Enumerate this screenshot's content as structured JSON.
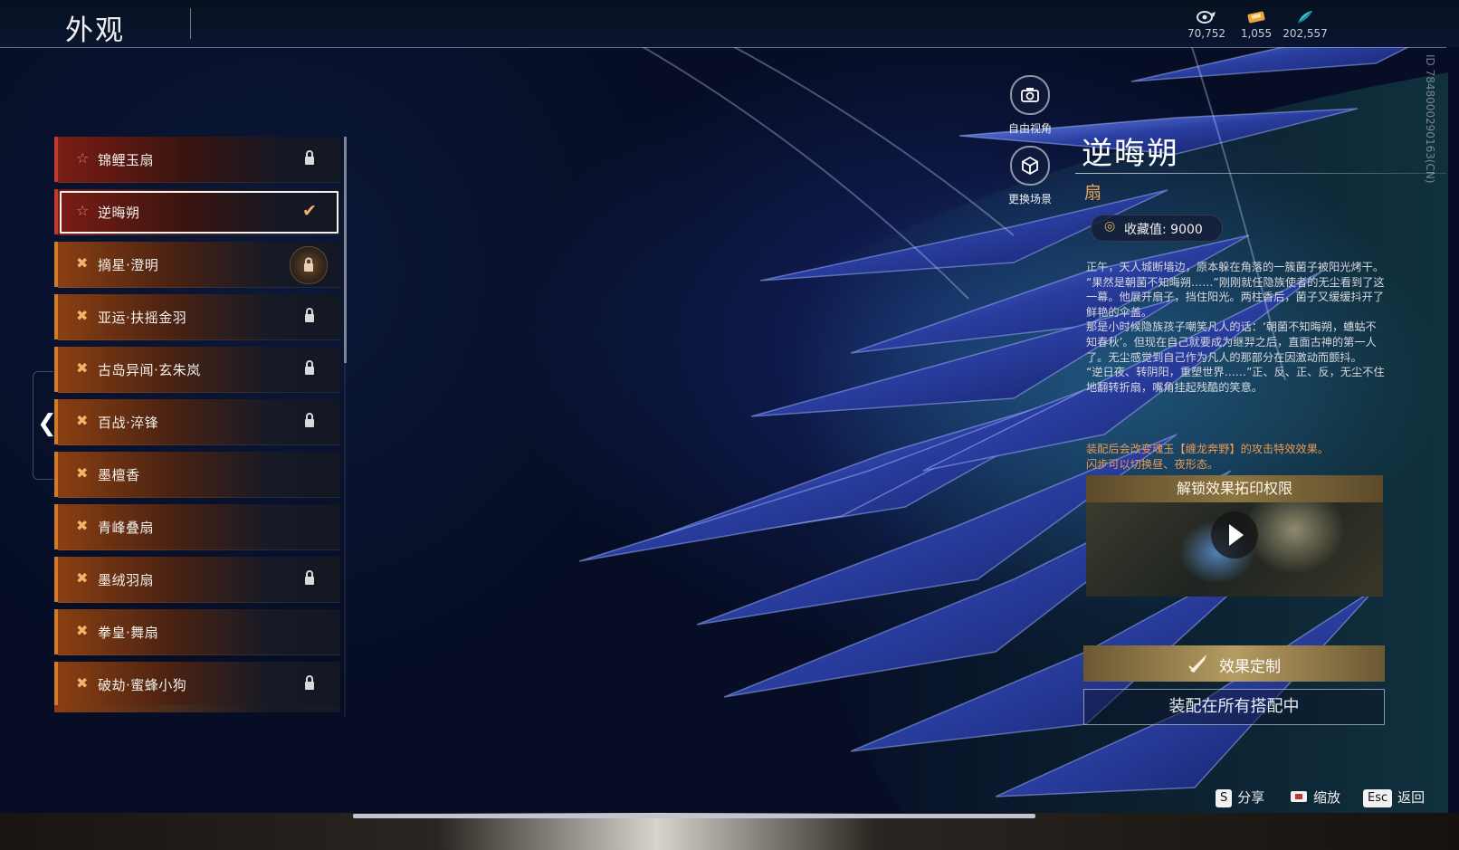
{
  "header": {
    "title": "外观",
    "currencies": [
      {
        "icon": "spirit-currency-icon",
        "value": "70,752"
      },
      {
        "icon": "ticket-currency-icon",
        "value": "1,055"
      },
      {
        "icon": "feather-currency-icon",
        "value": "202,557"
      }
    ]
  },
  "list": {
    "items": [
      {
        "label": "锦鲤玉扇",
        "rarity": "red",
        "status": "locked"
      },
      {
        "label": "逆晦朔",
        "rarity": "red",
        "status": "equipped",
        "selected": true
      },
      {
        "label": "摘星·澄明",
        "rarity": "orange",
        "status": "locked-badge"
      },
      {
        "label": "亚运·扶摇金羽",
        "rarity": "orange",
        "status": "locked"
      },
      {
        "label": "古岛异闻·玄朱岚",
        "rarity": "orange",
        "status": "locked"
      },
      {
        "label": "百战·淬锋",
        "rarity": "orange",
        "status": "locked"
      },
      {
        "label": "墨檀香",
        "rarity": "orange",
        "status": "none"
      },
      {
        "label": "青峰叠扇",
        "rarity": "orange",
        "status": "none"
      },
      {
        "label": "墨绒羽扇",
        "rarity": "orange",
        "status": "locked"
      },
      {
        "label": "拳皇·舞扇",
        "rarity": "orange",
        "status": "none"
      },
      {
        "label": "破劫·蜜蜂小狗",
        "rarity": "orange",
        "status": "locked"
      }
    ]
  },
  "view_buttons": {
    "free_camera": "自由视角",
    "change_scene": "更换场景"
  },
  "vertical_id": "ID 7848000290163(CN)",
  "detail": {
    "name": "逆晦朔",
    "type": "扇",
    "collection_value": "收藏值: 9000",
    "description": [
      "正午，天人城断墙边，原本躲在角落的一簇菌子被阳光烤干。",
      "“果然是朝菌不知晦朔……”刚刚就任隐族使者的无尘看到了这一幕。他展开扇子，挡住阳光。两柱香后，菌子又缓缓抖开了鲜艳的伞盖。",
      "那是小时候隐族孩子嘲笑凡人的话：‘朝菌不知晦朔，蟪蛄不知春秋’。但现在自己就要成为继羿之后，直面古神的第一人了。无尘感觉到自己作为凡人的那部分在因激动而颤抖。",
      "“逆日夜、转阴阳，重塑世界……”正、反、正、反，无尘不住地翻转折扇，嘴角挂起残酷的笑意。"
    ],
    "effect_note": [
      "装配后会改变魂玉【缠龙奔野】的攻击特效效果。",
      "闪步可以切换昼、夜形态。"
    ],
    "unlock_banner": "解锁效果拓印权限",
    "customize_button": "效果定制",
    "equip_all_button": "装配在所有搭配中"
  },
  "hints": [
    {
      "key": "S",
      "label": "分享"
    },
    {
      "key_icon": "zoom-icon",
      "label": "缩放"
    },
    {
      "key": "Esc",
      "label": "返回"
    }
  ],
  "colors": {
    "accent_gold": "#e3a45a",
    "rarity_red": "#c0392b",
    "rarity_orange": "#d07a2a",
    "effect_text": "#ea9a55"
  }
}
